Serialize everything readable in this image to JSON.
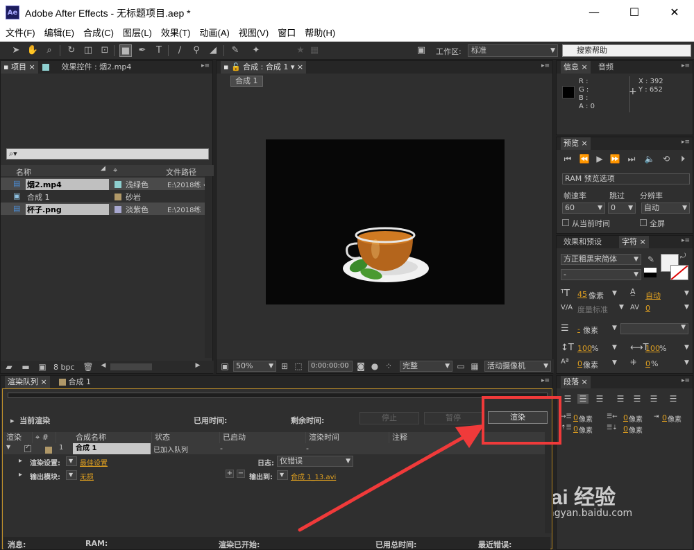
{
  "window": {
    "app_logo": "Ae",
    "title": "Adobe After Effects - 无标题项目.aep *",
    "min": "—",
    "max": "☐",
    "close": "✕"
  },
  "menu": [
    "文件(F)",
    "编辑(E)",
    "合成(C)",
    "图层(L)",
    "效果(T)",
    "动画(A)",
    "视图(V)",
    "窗口",
    "帮助(H)"
  ],
  "toolbar": {
    "workspace_label": "工作区:",
    "workspace_value": "标准",
    "help_search": "搜索帮助"
  },
  "project_panel": {
    "tab_project": "项目",
    "tab_effects": "效果控件 : 烟2.mp4",
    "search_placeholder": "",
    "columns": {
      "name": "名称",
      "path": "文件路径"
    },
    "items": [
      {
        "name": "烟2.mp4",
        "label": "浅绿色",
        "path": "E:\\2018练",
        "color": "#8ecfcf"
      },
      {
        "name": "合成 1",
        "label": "砂岩",
        "path": "",
        "color": "#b09868"
      },
      {
        "name": "杯子.png",
        "label": "淡紫色",
        "path": "E:\\2018练",
        "color": "#a8a8d0"
      }
    ],
    "bpc": "8 bpc"
  },
  "comp_panel": {
    "tab": "合成 : 合成 1",
    "breadcrumb": "合成 1",
    "zoom": "50%",
    "timecode": "0:00:00:00",
    "quality": "完整",
    "camera": "活动摄像机"
  },
  "info_panel": {
    "tab_info": "信息",
    "tab_audio": "音频",
    "r": "R :",
    "g": "G :",
    "b": "B :",
    "a": "A : 0",
    "x": "X : 392",
    "y": "Y : 652"
  },
  "preview_panel": {
    "tab": "预览",
    "ram_options": "RAM 预览选项",
    "frame_rate_label": "帧速率",
    "skip_label": "跳过",
    "resolution_label": "分辨率",
    "frame_rate": "60",
    "skip": "0",
    "resolution": "自动",
    "from_current": "从当前时间",
    "full_screen": "全屏"
  },
  "character_panel": {
    "tab_effects": "效果和预设",
    "tab_char": "字符",
    "font": "方正粗黑宋简体",
    "style": "-",
    "size": "45",
    "size_unit": "像素",
    "leading": "自动",
    "kerning": "度量标准",
    "tracking": "0",
    "stroke": "-",
    "stroke_unit": "像素",
    "vscale": "100",
    "hscale": "100",
    "pct": "%",
    "baseline": "0",
    "baseline_unit": "像素",
    "tsume": "0"
  },
  "paragraph_panel": {
    "tab": "段落",
    "indent_left": "0",
    "indent_right": "0",
    "indent_first": "0",
    "space_before": "0",
    "space_after": "0",
    "unit": "像素"
  },
  "render_panel": {
    "tab_render": "渲染队列",
    "tab_comp": "合成 1",
    "current_render": "当前渲染",
    "elapsed": "已用时间:",
    "remaining": "剩余时间:",
    "stop": "停止",
    "pause": "暂停",
    "render": "渲染",
    "columns": [
      "渲染",
      "#",
      "合成名称",
      "状态",
      "已启动",
      "渲染时间",
      "注释"
    ],
    "row": {
      "num": "1",
      "name": "合成 1",
      "status": "已加入队列",
      "started": "-",
      "time": "-"
    },
    "render_settings_label": "渲染设置:",
    "render_settings": "最佳设置",
    "log_label": "日志:",
    "log_value": "仅错误",
    "output_module_label": "输出模块:",
    "output_module": "无损",
    "output_to_label": "输出到:",
    "output_to": "合成 1_13.avi",
    "status_bar": {
      "message": "消息:",
      "ram": "RAM:",
      "render_started": "渲染已开始:",
      "total_time": "已用总时间:",
      "last_error": "最近错误:"
    }
  },
  "watermark": {
    "brand": "Bai 经验",
    "url": "jingyan.baidu.com"
  }
}
